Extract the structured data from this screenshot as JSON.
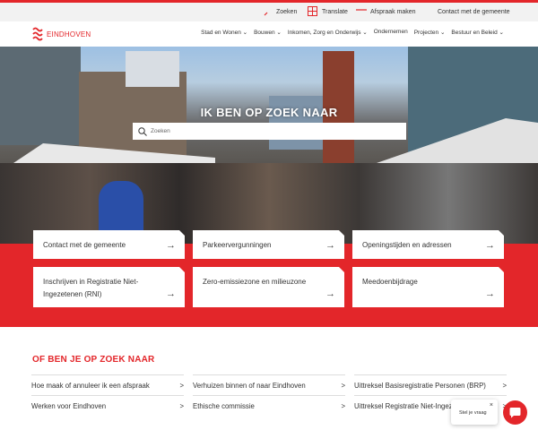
{
  "utility": {
    "search": "Zoeken",
    "translate": "Translate",
    "appointment": "Afspraak maken",
    "contact": "Contact met de gemeente"
  },
  "logo": "EINDHOVEN",
  "menu": [
    "Stad en Wonen ⌄",
    "Bouwen ⌄",
    "Inkomen, Zorg en Onderwijs ⌄",
    "Ondernemen",
    "Projecten ⌄",
    "Bestuur en Beleid ⌄"
  ],
  "hero": {
    "title": "IK BEN OP ZOEK NAAR",
    "search_placeholder": "Zoeken"
  },
  "cards": [
    "Contact met de gemeente",
    "Parkeervergunningen",
    "Openingstijden en adressen",
    "Inschrijven in Registratie Niet-Ingezetenen (RNI)",
    "Zero-emissiezone en milieuzone",
    "Meedoenbijdrage"
  ],
  "arrow": "→",
  "more": {
    "title": "OF BEN JE OP ZOEK NAAR",
    "links": [
      "Hoe maak of annuleer ik een afspraak",
      "Verhuizen binnen of naar Eindhoven",
      "Uittreksel Basisregistratie Personen (BRP)",
      "Werken voor Eindhoven",
      "Ethische commissie",
      "Uittreksel Registratie Niet-Ingezetenen (RNI)"
    ],
    "chevron": ">"
  },
  "chat": {
    "label": "Stel je vraag",
    "close": "×"
  },
  "colors": {
    "brand": "#e3262a"
  }
}
